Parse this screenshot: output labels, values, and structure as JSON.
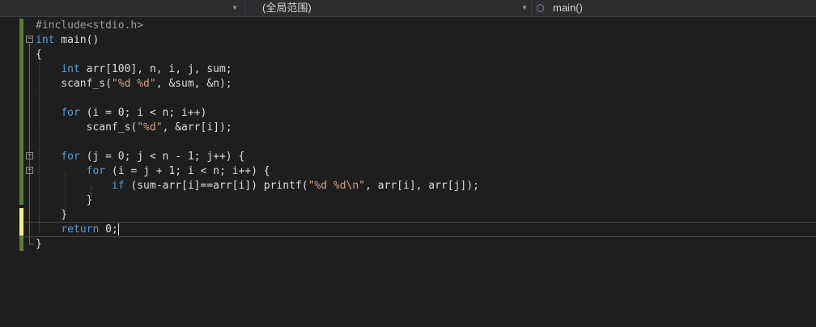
{
  "toolbar": {
    "project_dropdown": "",
    "scope_dropdown": "(全局范围)",
    "member_dropdown": "main()",
    "member_icon": "cube-icon"
  },
  "editor": {
    "lines": [
      "#include<stdio.h>",
      "int main()",
      "{",
      "    int arr[100], n, i, j, sum;",
      "    scanf_s(\"%d %d\", &sum, &n);",
      "",
      "    for (i = 0; i < n; i++)",
      "        scanf_s(\"%d\", &arr[i]);",
      "",
      "    for (j = 0; j < n - 1; j++) {",
      "        for (i = j + 1; i < n; i++) {",
      "            if (sum-arr[i]==arr[i]) printf(\"%d %d\\n\", arr[i], arr[j]);",
      "        }",
      "    }",
      "    return 0;",
      "}"
    ]
  },
  "colors": {
    "keyword": "#569cd6",
    "string": "#d69d85",
    "preprocessor": "#9b9b9b",
    "text": "#dcdcdc",
    "background": "#1e1e1e"
  }
}
